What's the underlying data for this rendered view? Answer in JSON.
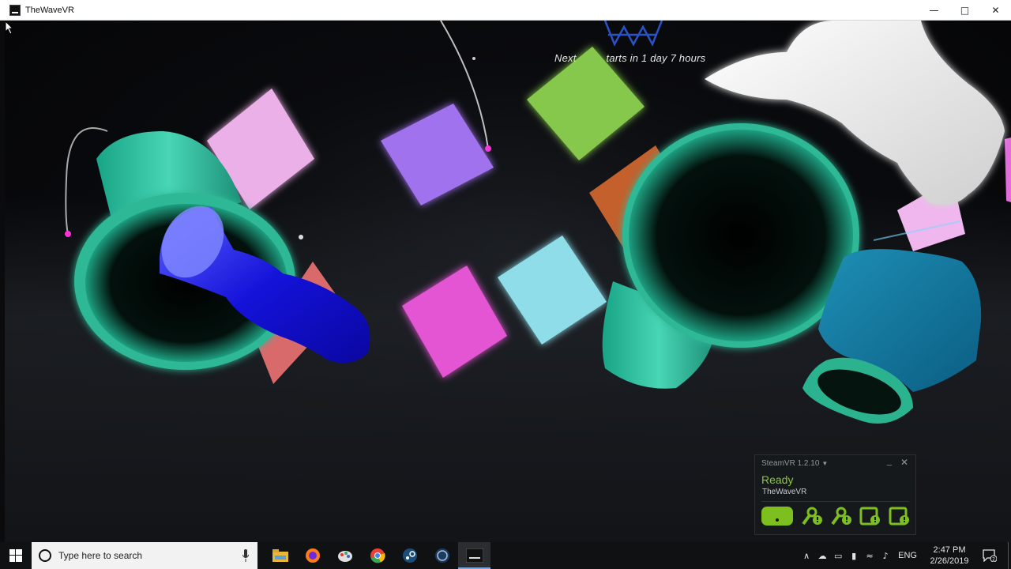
{
  "window": {
    "title": "TheWaveVR",
    "minimize_icon": "minimize-icon",
    "maximize_icon": "maximize-icon",
    "close_icon": "close-icon"
  },
  "scene": {
    "next_prefix": "Next",
    "next_suffix": "tarts in 1 day 7 hours"
  },
  "steamvr": {
    "title": "SteamVR 1.2.10",
    "status": "Ready",
    "app": "TheWaveVR",
    "accent_color": "#7cbf1f",
    "devices": [
      "headset-icon",
      "controller-icon",
      "controller-icon",
      "base-station-icon",
      "base-station-icon"
    ]
  },
  "taskbar": {
    "search_placeholder": "Type here to search",
    "apps": [
      "file-explorer-icon",
      "firefox-icon",
      "paint-icon",
      "chrome-icon",
      "steam-icon",
      "steamvr-icon",
      "thewavevr-icon"
    ],
    "language": "ENG",
    "time": "2:47 PM",
    "date": "2/26/2019",
    "notification_count": "2"
  }
}
